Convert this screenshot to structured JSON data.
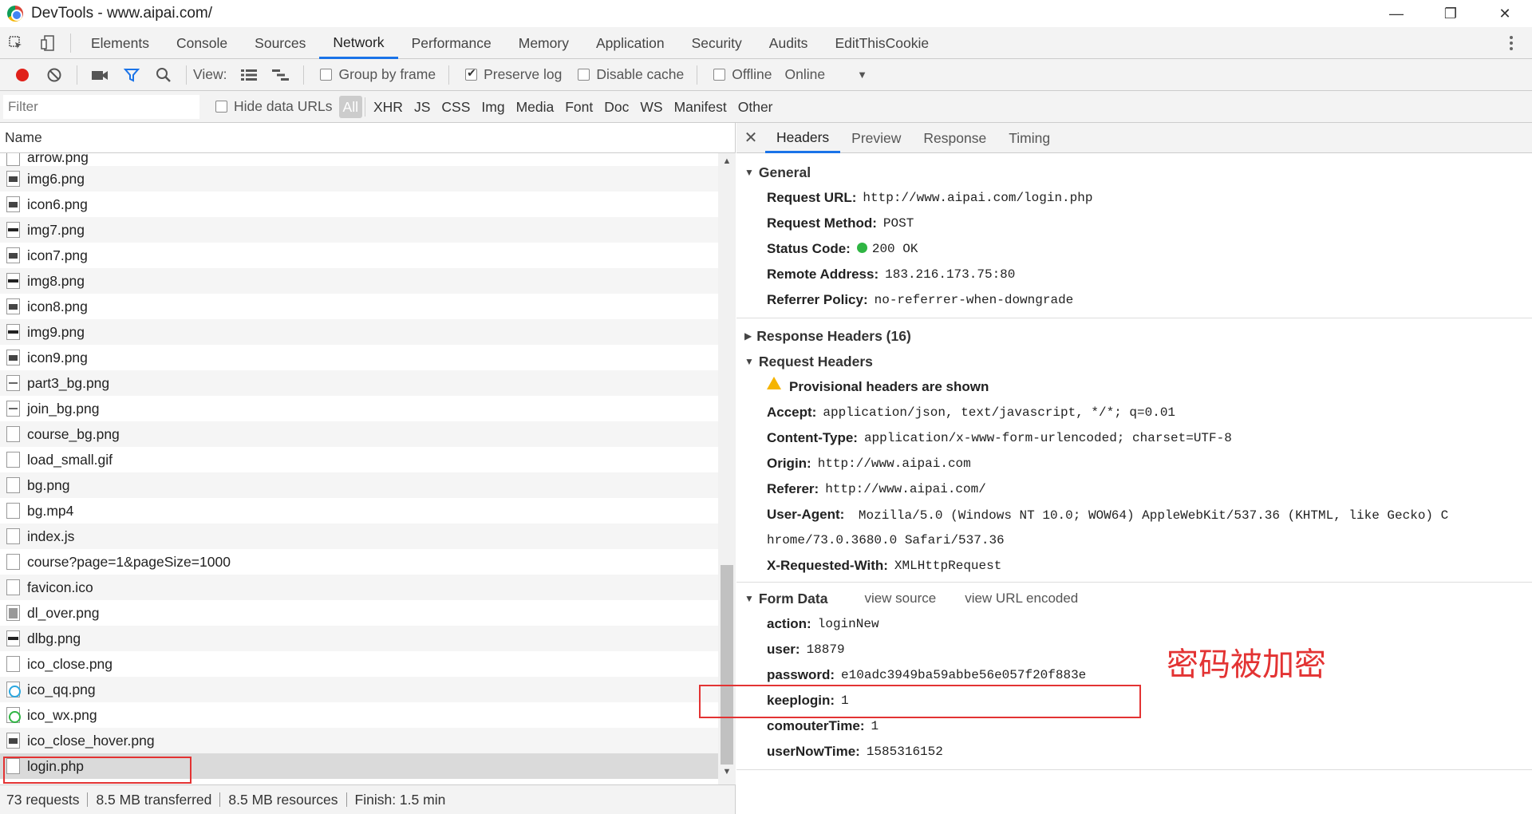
{
  "window": {
    "title": "DevTools - www.aipai.com/",
    "buttons": [
      "—",
      "❐",
      "✕"
    ]
  },
  "panel_tabs": [
    "Elements",
    "Console",
    "Sources",
    "Network",
    "Performance",
    "Memory",
    "Application",
    "Security",
    "Audits",
    "EditThisCookie"
  ],
  "active_panel": "Network",
  "toolbar": {
    "view_label": "View:",
    "group_by_frame": "Group by frame",
    "preserve_log": "Preserve log",
    "disable_cache": "Disable cache",
    "offline": "Offline",
    "online": "Online"
  },
  "filterbar": {
    "placeholder": "Filter",
    "hide_data_urls": "Hide data URLs",
    "types": [
      "All",
      "XHR",
      "JS",
      "CSS",
      "Img",
      "Media",
      "Font",
      "Doc",
      "WS",
      "Manifest",
      "Other"
    ]
  },
  "left": {
    "column_header": "Name",
    "requests": [
      {
        "name": "arrow.png",
        "icon": "file-blank-icon"
      },
      {
        "name": "img6.png",
        "icon": "image-thumbnail-icon"
      },
      {
        "name": "icon6.png",
        "icon": "image-thumbnail-icon"
      },
      {
        "name": "img7.png",
        "icon": "image-thumbnail-icon"
      },
      {
        "name": "icon7.png",
        "icon": "image-thumbnail-icon"
      },
      {
        "name": "img8.png",
        "icon": "image-thumbnail-icon"
      },
      {
        "name": "icon8.png",
        "icon": "image-thumbnail-icon"
      },
      {
        "name": "img9.png",
        "icon": "image-thumbnail-icon"
      },
      {
        "name": "icon9.png",
        "icon": "image-thumbnail-icon"
      },
      {
        "name": "part3_bg.png",
        "icon": "image-thumbnail-icon"
      },
      {
        "name": "join_bg.png",
        "icon": "image-thumbnail-icon"
      },
      {
        "name": "course_bg.png",
        "icon": "file-blank-icon"
      },
      {
        "name": "load_small.gif",
        "icon": "file-blank-icon"
      },
      {
        "name": "bg.png",
        "icon": "file-blank-icon"
      },
      {
        "name": "bg.mp4",
        "icon": "file-blank-icon"
      },
      {
        "name": "index.js",
        "icon": "file-blank-icon"
      },
      {
        "name": "course?page=1&pageSize=1000",
        "icon": "file-blank-icon"
      },
      {
        "name": "favicon.ico",
        "icon": "file-blank-icon"
      },
      {
        "name": "dl_over.png",
        "icon": "image-thumbnail-icon"
      },
      {
        "name": "dlbg.png",
        "icon": "image-thumbnail-icon"
      },
      {
        "name": "ico_close.png",
        "icon": "file-blank-icon"
      },
      {
        "name": "ico_qq.png",
        "icon": "qq-icon"
      },
      {
        "name": "ico_wx.png",
        "icon": "wechat-icon"
      },
      {
        "name": "ico_close_hover.png",
        "icon": "image-thumbnail-icon"
      },
      {
        "name": "login.php",
        "icon": "file-blank-icon",
        "selected": true
      }
    ]
  },
  "statusbar": {
    "requests": "73 requests",
    "transferred": "8.5 MB transferred",
    "resources": "8.5 MB resources",
    "finish": "Finish: 1.5 min"
  },
  "detail": {
    "tabs": [
      "Headers",
      "Preview",
      "Response",
      "Timing"
    ],
    "active_tab": "Headers",
    "general": {
      "title": "General",
      "rows": [
        {
          "k": "Request URL:",
          "v": "http://www.aipai.com/login.php"
        },
        {
          "k": "Request Method:",
          "v": "POST"
        },
        {
          "k": "Status Code:",
          "v": "200 OK"
        },
        {
          "k": "Remote Address:",
          "v": "183.216.173.75:80"
        },
        {
          "k": "Referrer Policy:",
          "v": "no-referrer-when-downgrade"
        }
      ]
    },
    "response_headers": "Response Headers (16)",
    "request_headers": {
      "title": "Request Headers",
      "warning": "Provisional headers are shown",
      "rows": [
        {
          "k": "Accept:",
          "v": "application/json, text/javascript, */*; q=0.01"
        },
        {
          "k": "Content-Type:",
          "v": "application/x-www-form-urlencoded; charset=UTF-8"
        },
        {
          "k": "Origin:",
          "v": "http://www.aipai.com"
        },
        {
          "k": "Referer:",
          "v": "http://www.aipai.com/"
        },
        {
          "k": "User-Agent:",
          "v": "Mozilla/5.0 (Windows NT 10.0; WOW64) AppleWebKit/537.36 (KHTML, like Gecko) Chrome/73.0.3680.0 Safari/537.36"
        },
        {
          "k": "X-Requested-With:",
          "v": "XMLHttpRequest"
        }
      ]
    },
    "form_data": {
      "title": "Form Data",
      "view_source": "view source",
      "view_url_encoded": "view URL encoded",
      "rows": [
        {
          "k": "action:",
          "v": "loginNew"
        },
        {
          "k": "user:",
          "v": "18879"
        },
        {
          "k": "password:",
          "v": "e10adc3949ba59abbe56e057f20f883e"
        },
        {
          "k": "keeplogin:",
          "v": "1"
        },
        {
          "k": "comouterTime:",
          "v": "1"
        },
        {
          "k": "userNowTime:",
          "v": "1585316152"
        }
      ]
    }
  },
  "annotation": {
    "text": "密码被加密",
    "color": "#e33333"
  }
}
